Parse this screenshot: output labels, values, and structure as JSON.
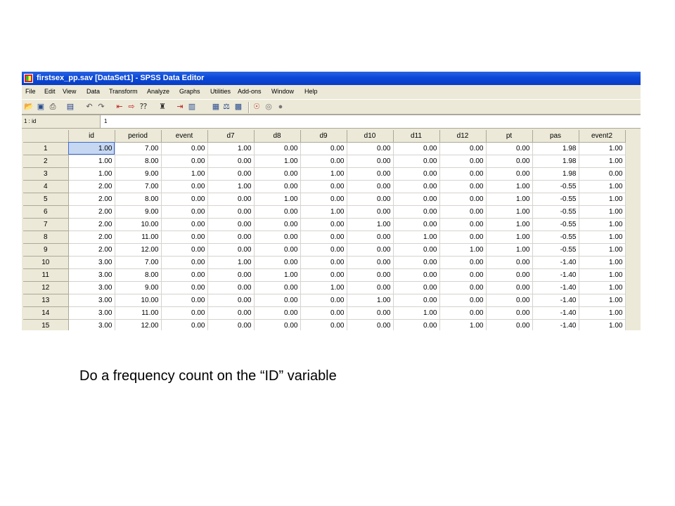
{
  "window": {
    "title": "firstsex_pp.sav [DataSet1] - SPSS Data Editor"
  },
  "menu": {
    "items": [
      "File",
      "Edit",
      "View",
      "Data",
      "Transform",
      "Analyze",
      "Graphs",
      "Utilities",
      "Add-ons",
      "Window",
      "Help"
    ]
  },
  "toolbar": {
    "icons": [
      "open-icon",
      "save-icon",
      "print-icon",
      "dialog-recall-icon",
      "undo-icon",
      "redo-icon",
      "goto-case-icon",
      "variables-icon",
      "find-icon",
      "insert-cases-icon",
      "insert-variable-icon",
      "split-file-icon",
      "weight-cases-icon",
      "select-cases-icon",
      "value-labels-icon",
      "use-sets-icon",
      "show-all-icon"
    ]
  },
  "cell_ref": {
    "label": "1 : id",
    "value": "1"
  },
  "grid": {
    "columns": [
      "id",
      "period",
      "event",
      "d7",
      "d8",
      "d9",
      "d10",
      "d11",
      "d12",
      "pt",
      "pas",
      "event2"
    ],
    "rows": [
      {
        "n": "1",
        "cells": [
          "1.00",
          "7.00",
          "0.00",
          "1.00",
          "0.00",
          "0.00",
          "0.00",
          "0.00",
          "0.00",
          "0.00",
          "1.98",
          "1.00"
        ]
      },
      {
        "n": "2",
        "cells": [
          "1.00",
          "8.00",
          "0.00",
          "0.00",
          "1.00",
          "0.00",
          "0.00",
          "0.00",
          "0.00",
          "0.00",
          "1.98",
          "1.00"
        ]
      },
      {
        "n": "3",
        "cells": [
          "1.00",
          "9.00",
          "1.00",
          "0.00",
          "0.00",
          "1.00",
          "0.00",
          "0.00",
          "0.00",
          "0.00",
          "1.98",
          "0.00"
        ]
      },
      {
        "n": "4",
        "cells": [
          "2.00",
          "7.00",
          "0.00",
          "1.00",
          "0.00",
          "0.00",
          "0.00",
          "0.00",
          "0.00",
          "1.00",
          "-0.55",
          "1.00"
        ]
      },
      {
        "n": "5",
        "cells": [
          "2.00",
          "8.00",
          "0.00",
          "0.00",
          "1.00",
          "0.00",
          "0.00",
          "0.00",
          "0.00",
          "1.00",
          "-0.55",
          "1.00"
        ]
      },
      {
        "n": "6",
        "cells": [
          "2.00",
          "9.00",
          "0.00",
          "0.00",
          "0.00",
          "1.00",
          "0.00",
          "0.00",
          "0.00",
          "1.00",
          "-0.55",
          "1.00"
        ]
      },
      {
        "n": "7",
        "cells": [
          "2.00",
          "10.00",
          "0.00",
          "0.00",
          "0.00",
          "0.00",
          "1.00",
          "0.00",
          "0.00",
          "1.00",
          "-0.55",
          "1.00"
        ]
      },
      {
        "n": "8",
        "cells": [
          "2.00",
          "11.00",
          "0.00",
          "0.00",
          "0.00",
          "0.00",
          "0.00",
          "1.00",
          "0.00",
          "1.00",
          "-0.55",
          "1.00"
        ]
      },
      {
        "n": "9",
        "cells": [
          "2.00",
          "12.00",
          "0.00",
          "0.00",
          "0.00",
          "0.00",
          "0.00",
          "0.00",
          "1.00",
          "1.00",
          "-0.55",
          "1.00"
        ]
      },
      {
        "n": "10",
        "cells": [
          "3.00",
          "7.00",
          "0.00",
          "1.00",
          "0.00",
          "0.00",
          "0.00",
          "0.00",
          "0.00",
          "0.00",
          "-1.40",
          "1.00"
        ]
      },
      {
        "n": "11",
        "cells": [
          "3.00",
          "8.00",
          "0.00",
          "0.00",
          "1.00",
          "0.00",
          "0.00",
          "0.00",
          "0.00",
          "0.00",
          "-1.40",
          "1.00"
        ]
      },
      {
        "n": "12",
        "cells": [
          "3.00",
          "9.00",
          "0.00",
          "0.00",
          "0.00",
          "1.00",
          "0.00",
          "0.00",
          "0.00",
          "0.00",
          "-1.40",
          "1.00"
        ]
      },
      {
        "n": "13",
        "cells": [
          "3.00",
          "10.00",
          "0.00",
          "0.00",
          "0.00",
          "0.00",
          "1.00",
          "0.00",
          "0.00",
          "0.00",
          "-1.40",
          "1.00"
        ]
      },
      {
        "n": "14",
        "cells": [
          "3.00",
          "11.00",
          "0.00",
          "0.00",
          "0.00",
          "0.00",
          "0.00",
          "1.00",
          "0.00",
          "0.00",
          "-1.40",
          "1.00"
        ]
      },
      {
        "n": "15",
        "cells": [
          "3.00",
          "12.00",
          "0.00",
          "0.00",
          "0.00",
          "0.00",
          "0.00",
          "0.00",
          "1.00",
          "0.00",
          "-1.40",
          "1.00"
        ]
      }
    ]
  },
  "instruction": "Do a frequency count on the “ID” variable",
  "colors": {
    "title_bar": "#0a48d8",
    "window_bg": "#ece9d8",
    "selected_cell": "#c6d7f2"
  }
}
